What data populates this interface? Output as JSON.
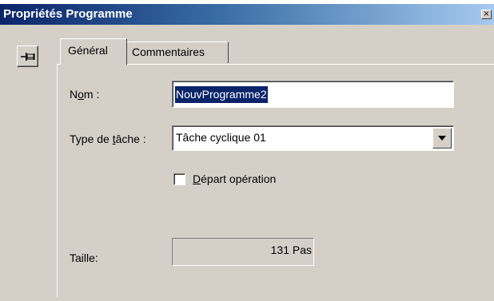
{
  "window": {
    "title": "Propriétés Programme",
    "close_glyph": "×"
  },
  "toolbar": {
    "pin_icon": "pin-icon"
  },
  "tabs": [
    {
      "label": "Général",
      "active": true
    },
    {
      "label": "Commentaires",
      "active": false
    }
  ],
  "form": {
    "name": {
      "label_pre": "N",
      "label_accel": "o",
      "label_post": "m :",
      "value": "NouvProgramme2"
    },
    "task_type": {
      "label_pre": "Type de ",
      "label_accel": "t",
      "label_post": "âche :",
      "selected": "Tâche cyclique 01"
    },
    "start_operation": {
      "label_accel": "D",
      "label_post": "épart opération",
      "checked": false
    },
    "size": {
      "label": "Taille:",
      "value": "131 Pas"
    }
  },
  "colors": {
    "face": "#d4d0c8",
    "title_start": "#0a246a",
    "title_end": "#a6caf0",
    "selection": "#0a246a"
  }
}
